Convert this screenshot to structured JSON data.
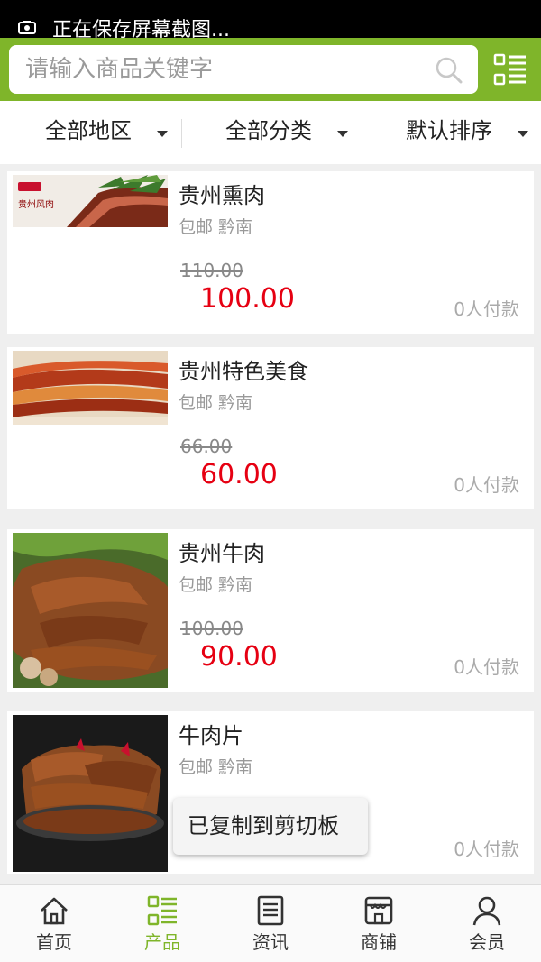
{
  "status_bar": {
    "notification_text": "正在保存屏幕截图..."
  },
  "search": {
    "placeholder": "请输入商品关键字"
  },
  "filters": [
    {
      "label": "全部地区"
    },
    {
      "label": "全部分类"
    },
    {
      "label": "默认排序"
    }
  ],
  "products": [
    {
      "title": "贵州熏肉",
      "meta": "包邮 黔南",
      "original_price": "110.00",
      "price": "100.00",
      "paid": "0人付款",
      "image_label": "贵州风肉"
    },
    {
      "title": "贵州特色美食",
      "meta": "包邮 黔南",
      "original_price": "66.00",
      "price": "60.00",
      "paid": "0人付款"
    },
    {
      "title": "贵州牛肉",
      "meta": "包邮 黔南",
      "original_price": "100.00",
      "price": "90.00",
      "paid": "0人付款"
    },
    {
      "title": "牛肉片",
      "meta": "包邮 黔南",
      "original_price": "",
      "price": "",
      "paid": "0人付款"
    }
  ],
  "toast": {
    "text": "已复制到剪切板"
  },
  "tabbar": [
    {
      "label": "首页",
      "icon": "home-icon"
    },
    {
      "label": "产品",
      "icon": "product-list-icon",
      "active": true
    },
    {
      "label": "资讯",
      "icon": "news-icon"
    },
    {
      "label": "商铺",
      "icon": "shop-icon"
    },
    {
      "label": "会员",
      "icon": "member-icon"
    }
  ],
  "colors": {
    "accent": "#7fb52a",
    "price": "#e60012",
    "muted": "#999999"
  }
}
